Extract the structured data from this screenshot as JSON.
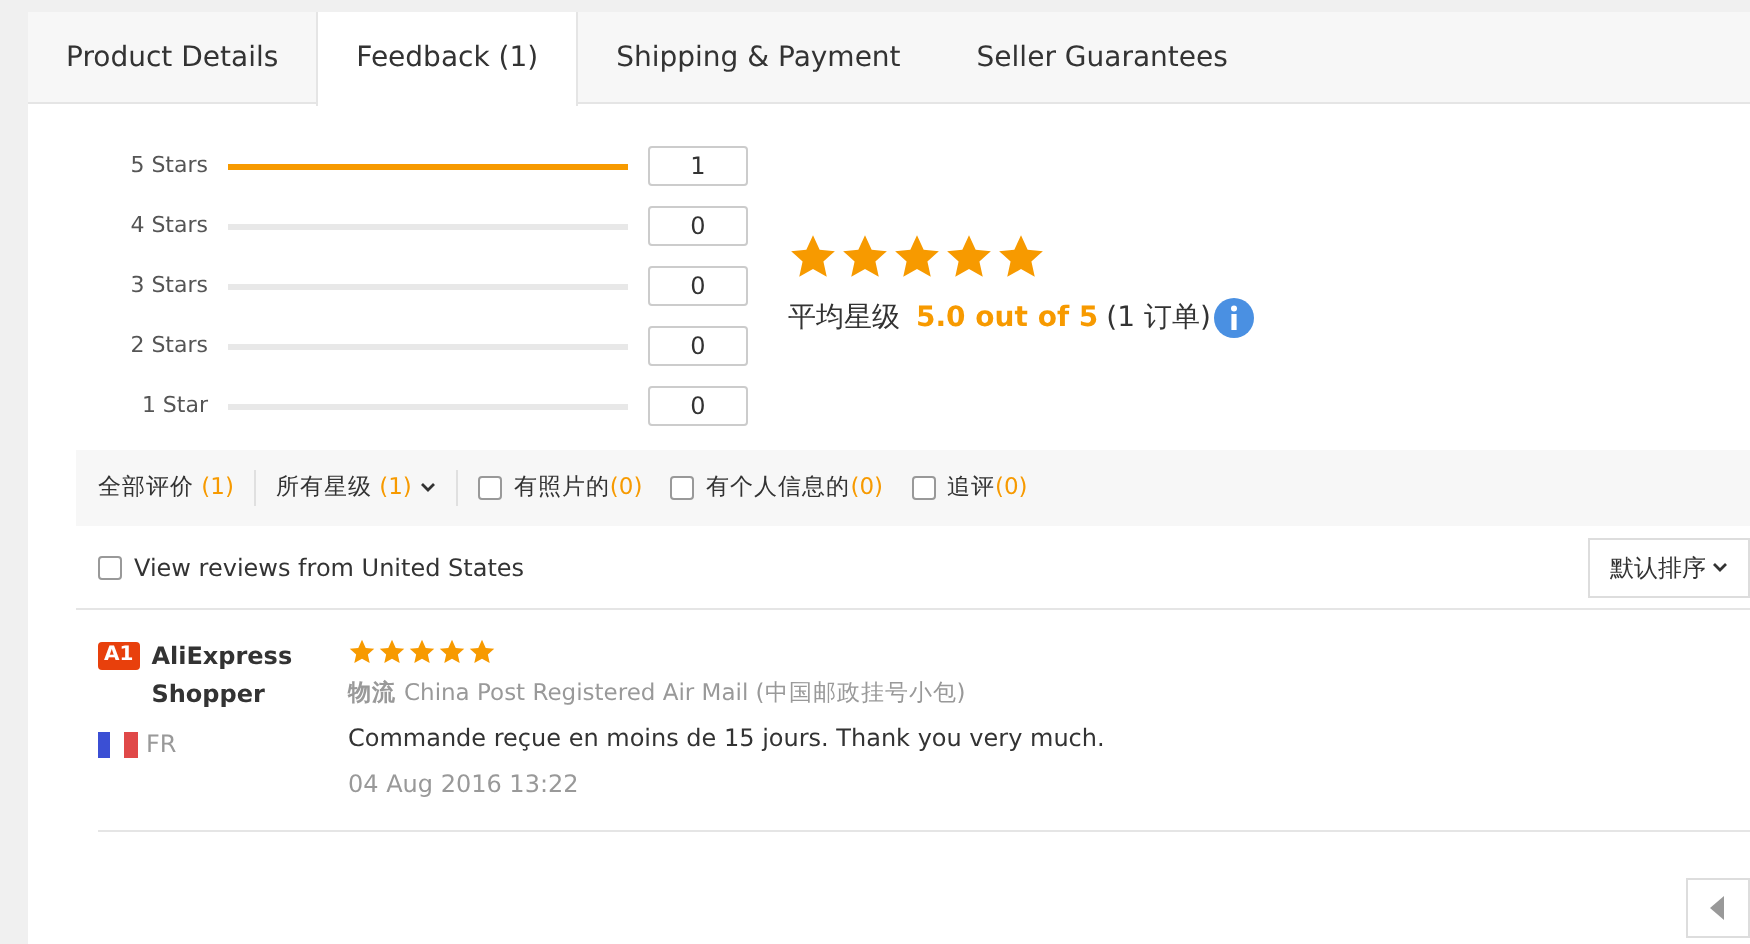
{
  "tabs": [
    {
      "label": "Product Details",
      "selected": false
    },
    {
      "label": "Feedback (1)",
      "selected": true
    },
    {
      "label": "Shipping & Payment",
      "selected": false
    },
    {
      "label": "Seller Guarantees",
      "selected": false
    }
  ],
  "histogram": [
    {
      "label": "5 Stars",
      "level": 1,
      "count": "1"
    },
    {
      "label": "4 Stars",
      "level": 0,
      "count": "0"
    },
    {
      "label": "3 Stars",
      "level": 0,
      "count": "0"
    },
    {
      "label": "2 Stars",
      "level": 0,
      "count": "0"
    },
    {
      "label": "1 Star",
      "level": 0,
      "count": "0"
    }
  ],
  "summary": {
    "stars": 5,
    "label": "平均星级",
    "score": "5.0 out of 5",
    "orders": "(1 订单)"
  },
  "filters": [
    {
      "kind": "text",
      "label": "全部评价",
      "count": "(1)"
    },
    {
      "kind": "dropdown",
      "label": "所有星级",
      "count": "(1)"
    },
    {
      "kind": "checkbox",
      "label": "有照片的",
      "count": "(0)",
      "checked": false
    },
    {
      "kind": "checkbox",
      "label": "有个人信息的",
      "count": "(0)",
      "checked": false
    },
    {
      "kind": "checkbox",
      "label": "追评",
      "count": "(0)",
      "checked": false
    }
  ],
  "country_filter": {
    "label": "View reviews from United States",
    "checked": false
  },
  "sort": {
    "label": "默认排序"
  },
  "reviews": [
    {
      "badge": "A1",
      "name": "AliExpress Shopper",
      "country": "FR",
      "stars": 5,
      "logistics_label": "物流",
      "logistics": "China Post Registered Air Mail (中国邮政挂号小包)",
      "comment": "Commande reçue en moins de 15 jours. Thank you very much.",
      "date": "04 Aug 2016 13:22"
    }
  ]
}
